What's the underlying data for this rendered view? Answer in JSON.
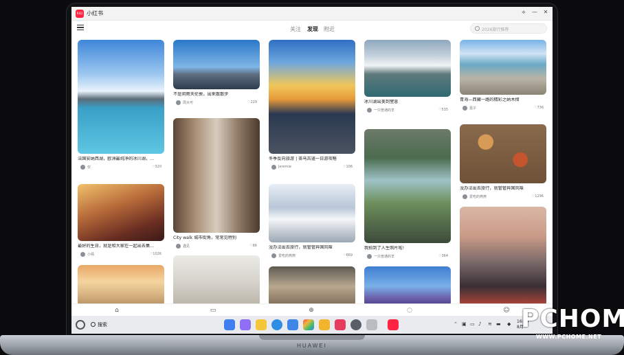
{
  "window": {
    "title": "小红书"
  },
  "nav": {
    "tabs": [
      {
        "label": "关注",
        "active": false
      },
      {
        "label": "发现",
        "active": true
      },
      {
        "label": "附近",
        "active": false
      }
    ],
    "search_placeholder": "2026旅行推荐"
  },
  "feed": {
    "columns": [
      [
        {
          "title": "法国安纳西湖，欧洲最纯净的冰川湖，...",
          "author": "仅",
          "likes": "320",
          "image": "lake-sky"
        },
        {
          "title": "最好的生日，就是和大家在一起出去集...",
          "author": "小倩",
          "likes": "1026",
          "image": "friends-party"
        },
        {
          "title": "",
          "author": "",
          "likes": "",
          "image": "dog-beach"
        }
      ],
      [
        {
          "title": "不是阴雨天伦敦，出来散散步",
          "author": "周大可",
          "likes": "229",
          "image": "london-eye"
        },
        {
          "title": "City walk 城市街角，常常见特别",
          "author": "遇见",
          "likes": "66",
          "image": "city-street"
        },
        {
          "title": "",
          "author": "",
          "likes": "",
          "image": "couple-room"
        }
      ],
      [
        {
          "title": "冬季反向旅游 | 茶马古道一日游攻略",
          "author": "Jeremie",
          "likes": "106",
          "image": "sunset-traveler"
        },
        {
          "title": "没办法出去旅行，就管管异国风味",
          "author": "爱吃的燕燕",
          "likes": "669",
          "image": "snow-climb"
        },
        {
          "title": "",
          "author": "",
          "likes": "",
          "image": "cafe-window"
        }
      ],
      [
        {
          "title": "冰川湖出美到窒息",
          "author": "一只普通的羊",
          "likes": "535",
          "image": "mountain-lake"
        },
        {
          "title": "我拍到了人生照片啦!",
          "author": "一只普通的羊",
          "likes": "364",
          "image": "selfie-lake"
        },
        {
          "title": "",
          "author": "",
          "likes": "",
          "image": "lavender"
        }
      ],
      [
        {
          "title": "青海—西藏一路的精彩之纳木措",
          "author": "嘉子",
          "likes": "736",
          "image": "yak-lake"
        },
        {
          "title": "没办法出去旅行，就管管异国风味",
          "author": "爱吃的燕燕",
          "likes": "1296",
          "image": "food-table"
        },
        {
          "title": "",
          "author": "",
          "likes": "",
          "image": "beijing-tower"
        }
      ]
    ]
  },
  "taskbar": {
    "search_label": "搜索",
    "clock_time": "16:00",
    "clock_date": "8月"
  },
  "laptop": {
    "brand": "HUAWEI"
  },
  "watermark": {
    "logo": "PCHOME",
    "url": "WWW.PCHOME.NET"
  },
  "colors": {
    "accent": "#ff2442",
    "screen_bg": "#ffffff",
    "taskbar_bg": "#e9ebef"
  }
}
